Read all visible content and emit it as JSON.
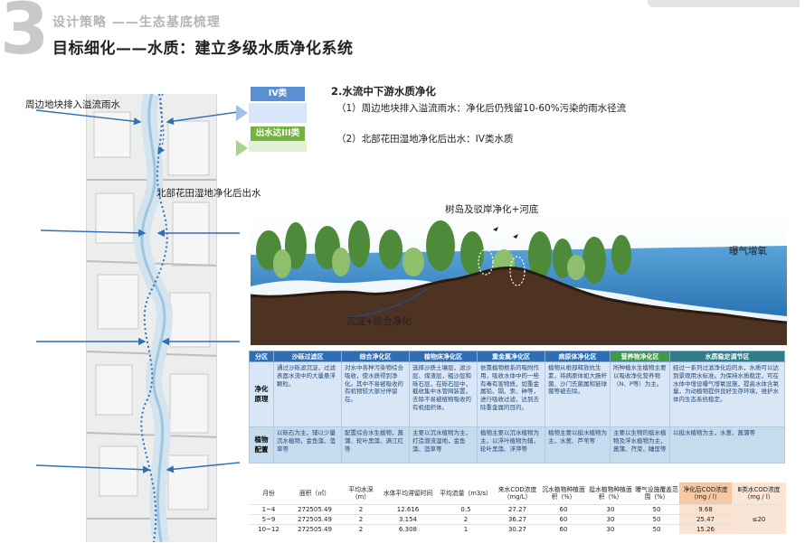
{
  "header": {
    "big_number": "3",
    "section": "设计策略 ——生态基底梳理",
    "title": "目标细化——水质：建立多级水质净化系统"
  },
  "callouts": {
    "overflow": "周边地块排入溢流雨水",
    "wetland": "北部花田湿地净化后出水",
    "treeisland": "树岛及驳岸净化+河底",
    "aeration": "曝气增氧",
    "sediment": "沉淀+综合净化"
  },
  "legend": {
    "iv": "IV类",
    "iii": "出水达III类"
  },
  "purification": {
    "title": "2.水流中下游水质净化",
    "item1": "（1）周边地块排入溢流雨水：净化后仍残留10-60%污染的雨水径流",
    "item2": "（2）北部花田湿地净化后出水：IV类水质"
  },
  "strategy_table": {
    "corner": "分区",
    "zones": [
      "沙砾过滤区",
      "综合净化区",
      "植物床净化区",
      "重金属净化区",
      "病原体净化区",
      "营养物净化区",
      "水质稳定调节区"
    ],
    "rows": [
      {
        "label": "净化原理",
        "cells": [
          "通过沙砾滤沉淀，过滤表面水流中的大量悬浮颗粒。",
          "对水中各种污染物综合吸收，使水质得到净化。其中不易被吸收的有机物较大部分停留在。",
          "选择沙质土壤层，滤沙层、煤渣层，粗沙层和砾石层，在砾石层中，截收集中水管网装置，去除不易被植物吸收的有机组织体。",
          "依靠植物根系的吸附作用，吸收水体中的一些有毒有害物质，如重金属铅、镉、汞、砷等，进行吸收过滤，达到去除重金属的目的。",
          "植物从根部释放抗生素，将病原体如大肠杆菌、沙门氏菌属和链球菌等被去除。",
          "所种植水生植物主要以吸收净化营养物（N、P等）为主。",
          "经过一系列过滤净化后的水，水质可以达到景观用水标准。为保持水质稳定，可在水体中增设曝气增氧设施，提高水体含氧量，为动植物提供良好生存环境，维护水体内生态系统稳定。"
        ]
      },
      {
        "label": "植物配置",
        "cells": [
          "以砾石为主，辅以少量沉水植物，金鱼藻、菹草等",
          "配置综合水生植物，菖蒲、轮叶黑藻、满江红等",
          "主要以沉水植物为主，打造潜流湿地，金鱼藻、菹草等",
          "植物主要以沉水植物为主，以浮叶植物为辅，轮叶黑藻、浮萍等",
          "植物主要以挺水植物为主，水葱、芦苇等",
          "主要以生物的挺水植物及浮水植物为主，菖蒲、荇菜、睡莲等",
          "以挺水植物为主，水葱、菖蒲等"
        ]
      }
    ]
  },
  "month_table": {
    "headers": [
      "月份",
      "面积（㎡）",
      "平均水深（m）",
      "水体平均滞留时间",
      "平均流量（m3/s）",
      "来水COD浓度（mg/L）",
      "沉水植物种植面积（%）",
      "挺水植物种植面积（%）",
      "曝气设施覆盖范围（%）",
      "净化后COD浓度（mg / l）",
      "Ⅲ类水COD浓度（mg / l）"
    ],
    "rows": [
      [
        "1~4",
        "272505.49",
        "2",
        "12.616",
        "0.5",
        "27.27",
        "60",
        "30",
        "50",
        "9.68"
      ],
      [
        "5~9",
        "272505.49",
        "2",
        "3.154",
        "2",
        "36.27",
        "60",
        "30",
        "50",
        "25.47"
      ],
      [
        "10~12",
        "272505.49",
        "2",
        "6.308",
        "1",
        "30.27",
        "60",
        "30",
        "50",
        "15.26"
      ]
    ],
    "limit": "≤20"
  },
  "colors": {
    "zone_header_blue": "#2f6db5",
    "zone_header_green": "#3d9a4a",
    "row_blue": "#d8e6f6",
    "peach": "#f6c9a4",
    "water": "#3a86c8"
  }
}
